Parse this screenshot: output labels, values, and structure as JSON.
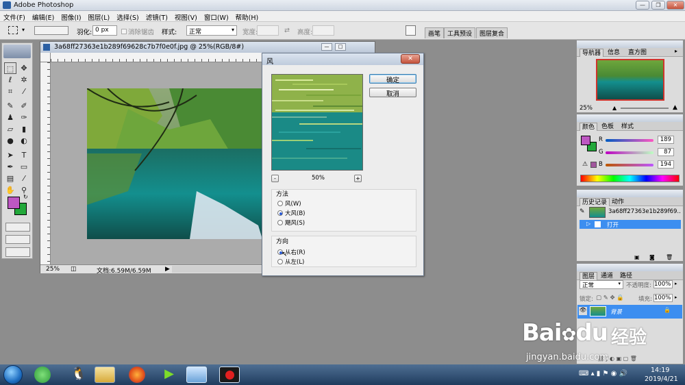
{
  "app": {
    "title": "Adobe Photoshop"
  },
  "menu": [
    "文件(F)",
    "编辑(E)",
    "图像(I)",
    "图层(L)",
    "选择(S)",
    "滤镜(T)",
    "视图(V)",
    "窗口(W)",
    "帮助(H)"
  ],
  "options": {
    "feather_label": "羽化:",
    "feather_value": "0 px",
    "antialias_label": "消除锯齿",
    "style_label": "样式:",
    "style_value": "正常",
    "width_label": "宽度:",
    "height_label": "高度:",
    "tabs": [
      "画笔",
      "工具预设",
      "图层复合"
    ]
  },
  "document": {
    "title": "3a68ff27363e1b289f69628c7b7f0e0f.jpg @ 25%(RGB/8#)",
    "zoom": "25%",
    "status": "文档:6.59M/6.59M"
  },
  "dialog": {
    "title": "风",
    "ok": "确定",
    "cancel": "取消",
    "zoom": "50%",
    "zoom_minus": "-",
    "zoom_plus": "+",
    "method_label": "方法",
    "method_options": [
      "风(W)",
      "大风(B)",
      "飓风(S)"
    ],
    "method_selected": 1,
    "direction_label": "方向",
    "direction_options": [
      "从右(R)",
      "从左(L)"
    ],
    "direction_selected": 0
  },
  "navigator": {
    "tabs": [
      "导航器",
      "信息",
      "直方图"
    ],
    "zoom": "25%"
  },
  "color": {
    "tabs": [
      "颜色",
      "色板",
      "样式"
    ],
    "channels": [
      {
        "label": "R",
        "value": "189"
      },
      {
        "label": "G",
        "value": "87"
      },
      {
        "label": "B",
        "value": "194"
      }
    ],
    "foreground": "#bd57c2",
    "background": "#22a83a"
  },
  "history": {
    "tabs": [
      "历史记录",
      "动作"
    ],
    "snapshot": "3a68ff27363e1b289f69...",
    "items": [
      "打开"
    ]
  },
  "layers": {
    "tabs": [
      "图层",
      "通道",
      "路径"
    ],
    "blend": "正常",
    "opacity_label": "不透明度:",
    "opacity": "100%",
    "lock_label": "锁定:",
    "fill_label": "填充:",
    "fill": "100%",
    "layer_name": "背景"
  },
  "taskbar": {
    "time": "14:19",
    "date": "2019/4/21"
  },
  "watermark": {
    "brand": "Bai",
    "brand2": "du",
    "cn": "经验",
    "url": "jingyan.baidu.com"
  }
}
